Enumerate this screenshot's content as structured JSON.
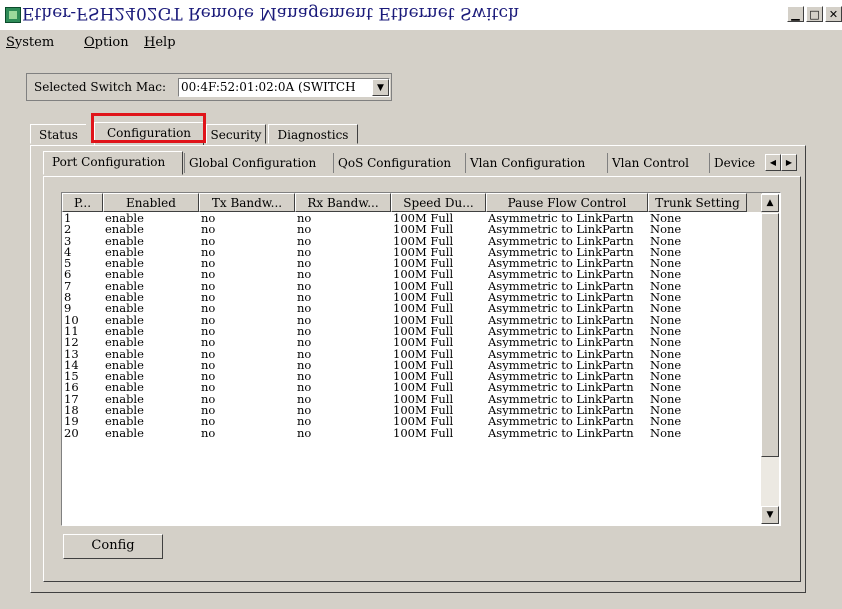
{
  "window": {
    "title": "Ether-FSH2402GT Remote Management Ethernet Switch",
    "controls": [
      "minimize",
      "maximize",
      "close"
    ]
  },
  "menu": [
    {
      "label": "System",
      "key": "S",
      "rest": "ystem"
    },
    {
      "label": "Option",
      "key": "O",
      "rest": "ption"
    },
    {
      "label": "Help",
      "key": "H",
      "rest": "elp"
    }
  ],
  "mac": {
    "label": "Selected Switch Mac:",
    "value": "00:4F:52:01:02:0A (SWITCH"
  },
  "tabs": [
    "Status",
    "Configuration",
    "Security",
    "Diagnostics"
  ],
  "active_tab": "Configuration",
  "subtabs": [
    "Port Configuration",
    "Global Configuration",
    "QoS Configuration",
    "Vlan Configuration",
    "Vlan Control",
    "Device"
  ],
  "active_subtab": "Port Configuration",
  "table": {
    "columns": [
      "P...",
      "Enabled",
      "Tx Bandw...",
      "Rx Bandw...",
      "Speed Du...",
      "Pause Flow Control",
      "Trunk Setting"
    ],
    "rows": [
      [
        "1",
        "enable",
        "no",
        "no",
        "100M Full",
        "Asymmetric to LinkPartn",
        "None"
      ],
      [
        "2",
        "enable",
        "no",
        "no",
        "100M Full",
        "Asymmetric to LinkPartn",
        "None"
      ],
      [
        "3",
        "enable",
        "no",
        "no",
        "100M Full",
        "Asymmetric to LinkPartn",
        "None"
      ],
      [
        "4",
        "enable",
        "no",
        "no",
        "100M Full",
        "Asymmetric to LinkPartn",
        "None"
      ],
      [
        "5",
        "enable",
        "no",
        "no",
        "100M Full",
        "Asymmetric to LinkPartn",
        "None"
      ],
      [
        "6",
        "enable",
        "no",
        "no",
        "100M Full",
        "Asymmetric to LinkPartn",
        "None"
      ],
      [
        "7",
        "enable",
        "no",
        "no",
        "100M Full",
        "Asymmetric to LinkPartn",
        "None"
      ],
      [
        "8",
        "enable",
        "no",
        "no",
        "100M Full",
        "Asymmetric to LinkPartn",
        "None"
      ],
      [
        "9",
        "enable",
        "no",
        "no",
        "100M Full",
        "Asymmetric to LinkPartn",
        "None"
      ],
      [
        "10",
        "enable",
        "no",
        "no",
        "100M Full",
        "Asymmetric to LinkPartn",
        "None"
      ],
      [
        "11",
        "enable",
        "no",
        "no",
        "100M Full",
        "Asymmetric to LinkPartn",
        "None"
      ],
      [
        "12",
        "enable",
        "no",
        "no",
        "100M Full",
        "Asymmetric to LinkPartn",
        "None"
      ],
      [
        "13",
        "enable",
        "no",
        "no",
        "100M Full",
        "Asymmetric to LinkPartn",
        "None"
      ],
      [
        "14",
        "enable",
        "no",
        "no",
        "100M Full",
        "Asymmetric to LinkPartn",
        "None"
      ],
      [
        "15",
        "enable",
        "no",
        "no",
        "100M Full",
        "Asymmetric to LinkPartn",
        "None"
      ],
      [
        "16",
        "enable",
        "no",
        "no",
        "100M Full",
        "Asymmetric to LinkPartn",
        "None"
      ],
      [
        "17",
        "enable",
        "no",
        "no",
        "100M Full",
        "Asymmetric to LinkPartn",
        "None"
      ],
      [
        "18",
        "enable",
        "no",
        "no",
        "100M Full",
        "Asymmetric to LinkPartn",
        "None"
      ],
      [
        "19",
        "enable",
        "no",
        "no",
        "100M Full",
        "Asymmetric to LinkPartn",
        "None"
      ],
      [
        "20",
        "enable",
        "no",
        "no",
        "100M Full",
        "Asymmetric to LinkPartn",
        "None"
      ]
    ]
  },
  "config_button": "Config",
  "highlight_color": "#e0141a"
}
